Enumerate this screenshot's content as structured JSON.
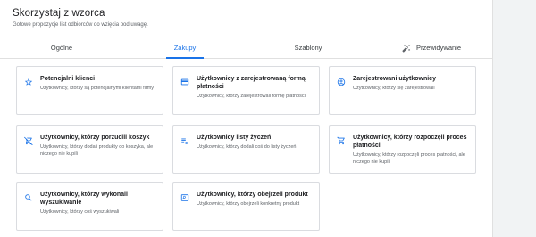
{
  "header": {
    "title": "Skorzystaj z wzorca",
    "subtitle": "Gotowe propozycje list odbiorców do wzięcia pod uwagę."
  },
  "tabs": [
    {
      "label": "Ogólne",
      "active": false
    },
    {
      "label": "Zakupy",
      "active": true
    },
    {
      "label": "Szablony",
      "active": false
    },
    {
      "label": "Przewidywanie",
      "active": false,
      "icon": "sparkle-icon"
    }
  ],
  "colors": {
    "accent": "#1a73e8",
    "border": "#dadce0",
    "muted": "#5f6368"
  },
  "cards": [
    {
      "title": "Potencjalni klienci",
      "desc": "Użytkownicy, którzy są potencjalnymi klientami firmy",
      "icon": "star-icon"
    },
    {
      "title": "Użytkownicy z zarejestrowaną formą płatności",
      "desc": "Użytkownicy, którzy zarejestrowali formę płatności",
      "icon": "credit-card-icon"
    },
    {
      "title": "Zarejestrowani użytkownicy",
      "desc": "Użytkownicy, którzy się zarejestrowali",
      "icon": "account-circle-icon"
    },
    {
      "title": "Użytkownicy, którzy porzucili koszyk",
      "desc": "Użytkownicy, którzy dodali produkty do koszyka, ale niczego nie kupili",
      "icon": "remove-cart-icon"
    },
    {
      "title": "Użytkownicy listy życzeń",
      "desc": "Użytkownicy, którzy dodali coś do listy życzeń",
      "icon": "playlist-add-check-icon"
    },
    {
      "title": "Użytkownicy, którzy rozpoczęli proces płatności",
      "desc": "Użytkownicy, którzy rozpoczęli proces płatności, ale niczego nie kupili",
      "icon": "shopping-cart-icon"
    },
    {
      "title": "Użytkownicy, którzy wykonali wyszukiwanie",
      "desc": "Użytkownicy, którzy coś wyszukiwali",
      "icon": "search-icon"
    },
    {
      "title": "Użytkownicy, którzy obejrzeli produkt",
      "desc": "Użytkownicy, którzy obejrzeli konkretny produkt",
      "icon": "product-search-icon"
    }
  ]
}
